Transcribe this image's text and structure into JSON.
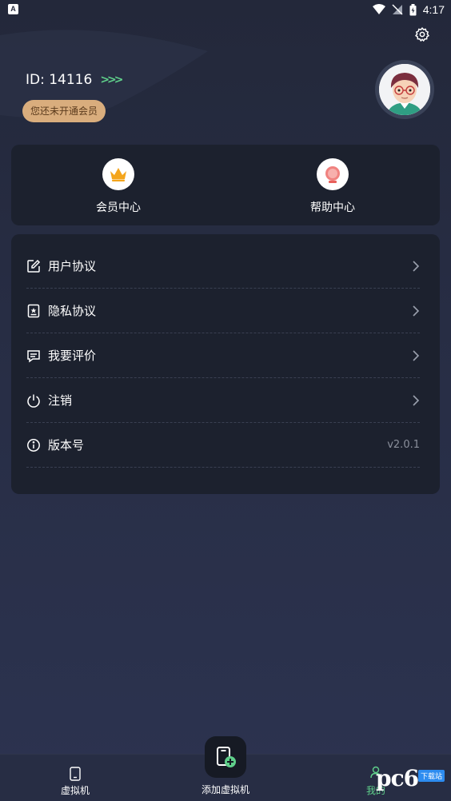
{
  "status_bar": {
    "time": "4:17",
    "notification_glyph": "A"
  },
  "profile": {
    "id_text": "ID: 14116",
    "arrows": ">>>",
    "vip_badge": "您还未开通会员"
  },
  "quick_actions": [
    {
      "label": "会员中心",
      "icon": "crown-icon"
    },
    {
      "label": "帮助中心",
      "icon": "help-icon"
    }
  ],
  "menu": [
    {
      "label": "用户协议",
      "icon": "edit-doc-icon"
    },
    {
      "label": "隐私协议",
      "icon": "privacy-doc-icon"
    },
    {
      "label": "我要评价",
      "icon": "comment-icon"
    },
    {
      "label": "注销",
      "icon": "power-icon"
    },
    {
      "label": "版本号",
      "icon": "info-icon",
      "value": "v2.0.1"
    }
  ],
  "bottom_nav": {
    "vm_label": "虚拟机",
    "add_label": "添加虚拟机",
    "me_label": "我的"
  },
  "watermark": {
    "text": "pc6",
    "sub": "下载站"
  },
  "colors": {
    "accent": "#5fcf8a",
    "vip": "#d9ad7d",
    "card": "#1c212e"
  }
}
